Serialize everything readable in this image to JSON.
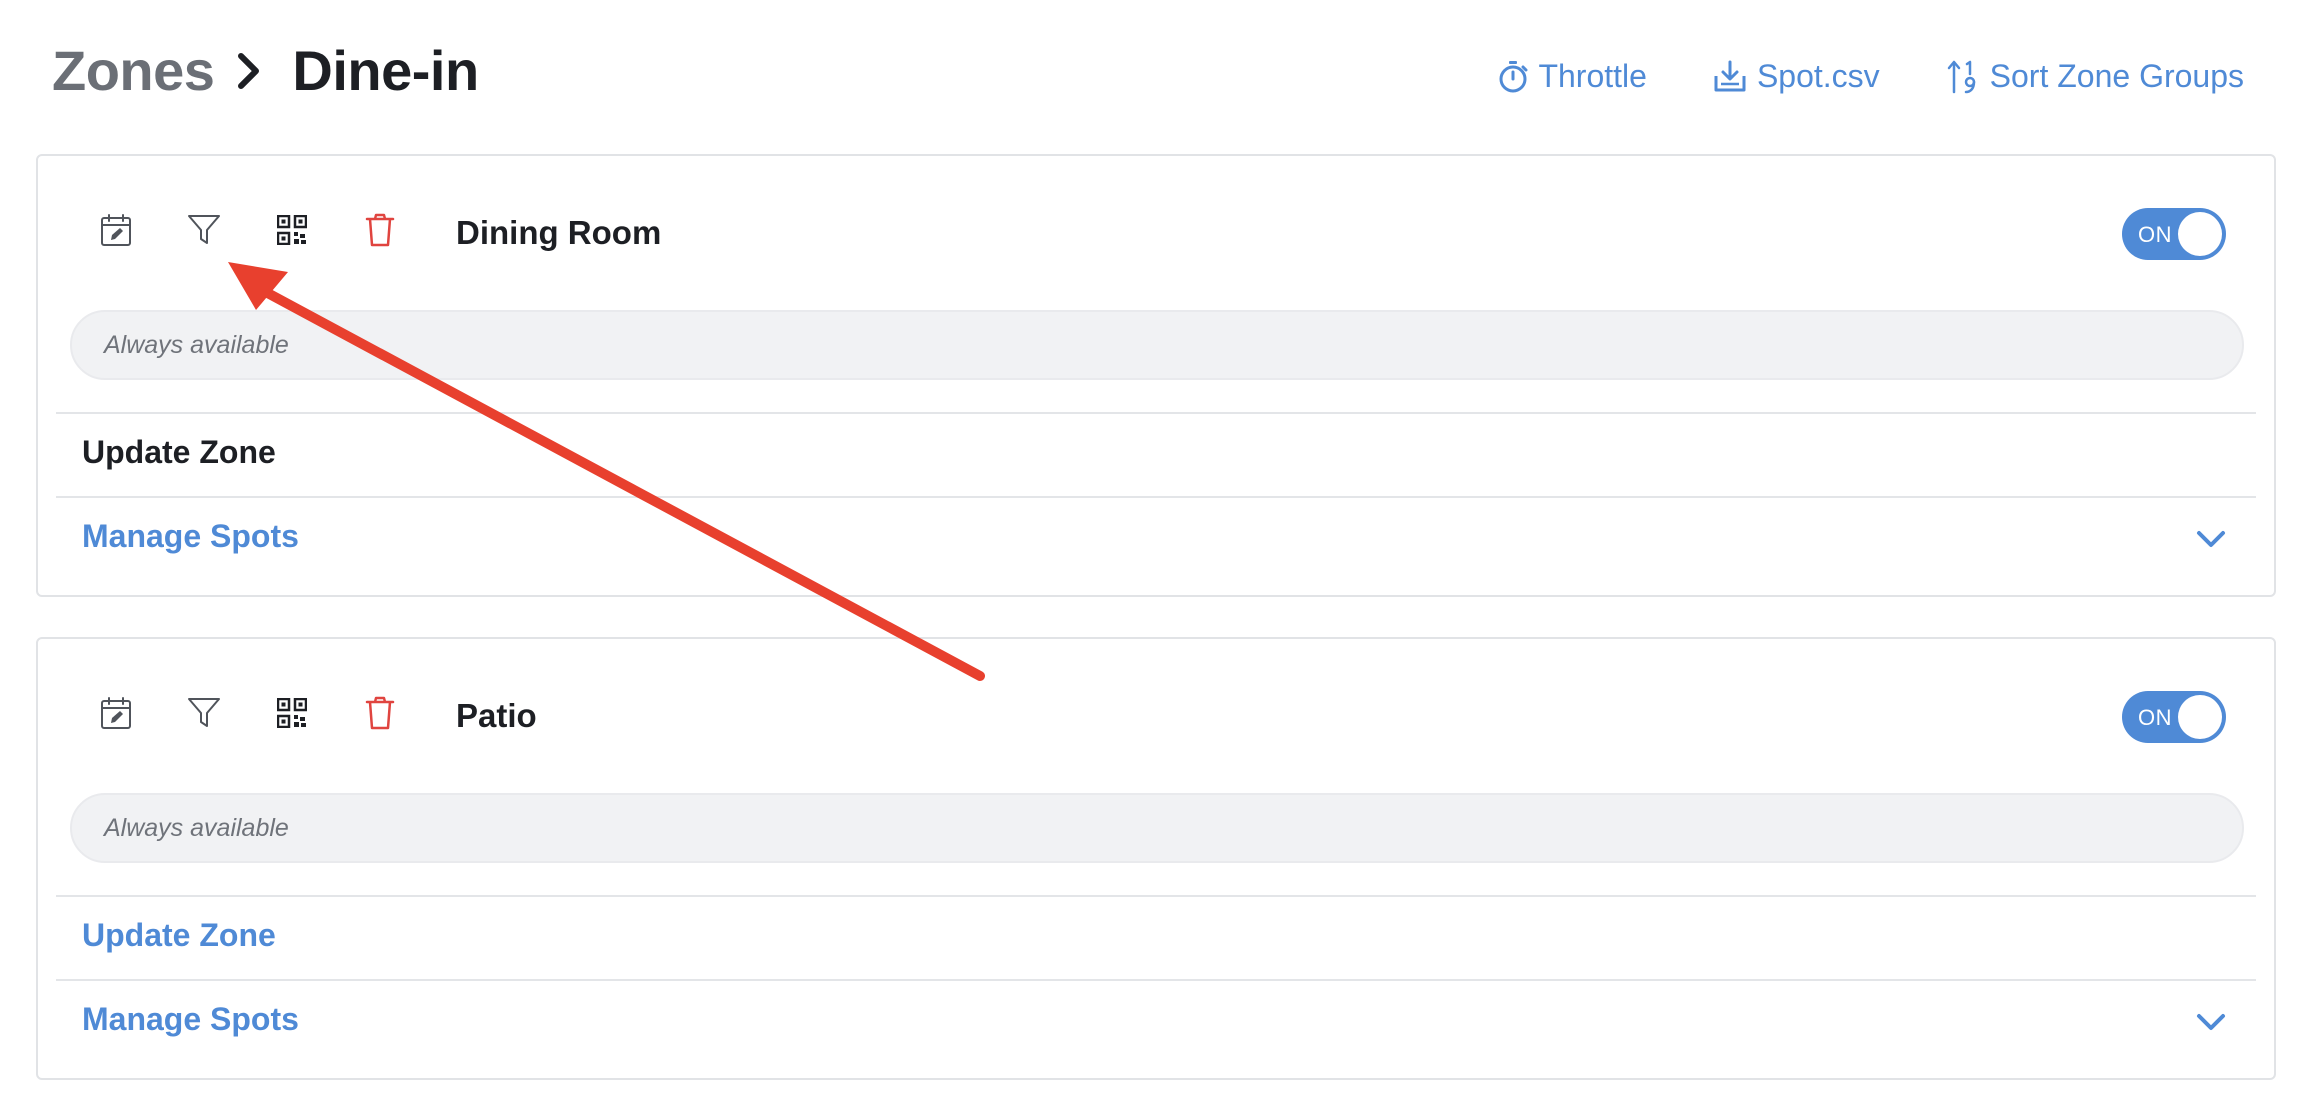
{
  "breadcrumb": {
    "parent": "Zones",
    "current": "Dine-in"
  },
  "header_actions": [
    {
      "label": "Throttle",
      "icon": "stopwatch-icon"
    },
    {
      "label": "Spot.csv",
      "icon": "download-icon"
    },
    {
      "label": "Sort Zone Groups",
      "icon": "sort-numeric-icon"
    }
  ],
  "zones": [
    {
      "name": "Dining Room",
      "toggle": "ON",
      "availability": "Always available",
      "update_label": "Update Zone",
      "manage_label": "Manage Spots"
    },
    {
      "name": "Patio",
      "toggle": "ON",
      "availability": "Always available",
      "update_label": "Update Zone",
      "manage_label": "Manage Spots"
    }
  ],
  "colors": {
    "accent": "#4f8ad6",
    "danger": "#e0443f",
    "annotation": "#e8402e"
  },
  "annotation": {
    "type": "arrow",
    "points_to": "filter-icon"
  }
}
